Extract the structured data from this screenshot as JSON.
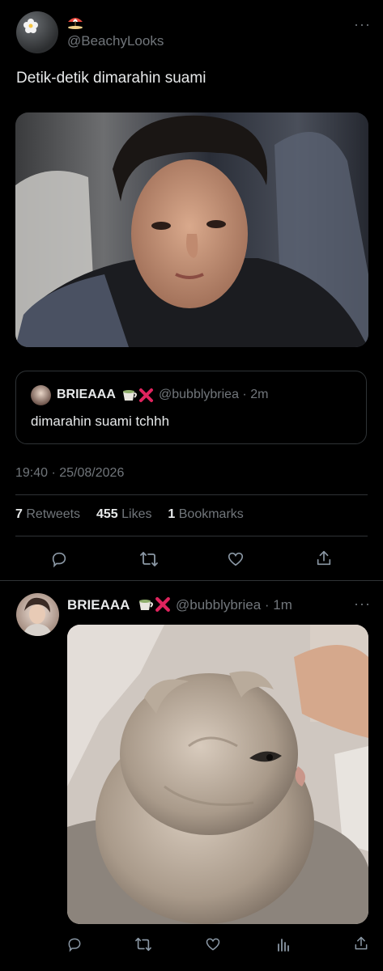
{
  "tweet": {
    "handle": "@BeachyLooks",
    "text": "Detik-detik dimarahin suami",
    "time": "19:40 · 25/08/2026",
    "stats": {
      "retweets_count": "7",
      "retweets_label": "Retweets",
      "likes_count": "455",
      "likes_label": "Likes",
      "bookmarks_count": "1",
      "bookmarks_label": "Bookmarks"
    }
  },
  "quote": {
    "name": "BRIEAAA",
    "handle_time": "@bubblybriea · 2m",
    "text": "dimarahin suami tchhh"
  },
  "reply": {
    "name": "BRIEAAA",
    "handle_time": "@bubblybriea · 1m"
  },
  "more_glyph": "···",
  "colors": {
    "background": "#000000",
    "text": "#e7e9ea",
    "muted": "#71767b",
    "border": "#2f3336",
    "red_x": "#e0245e"
  }
}
